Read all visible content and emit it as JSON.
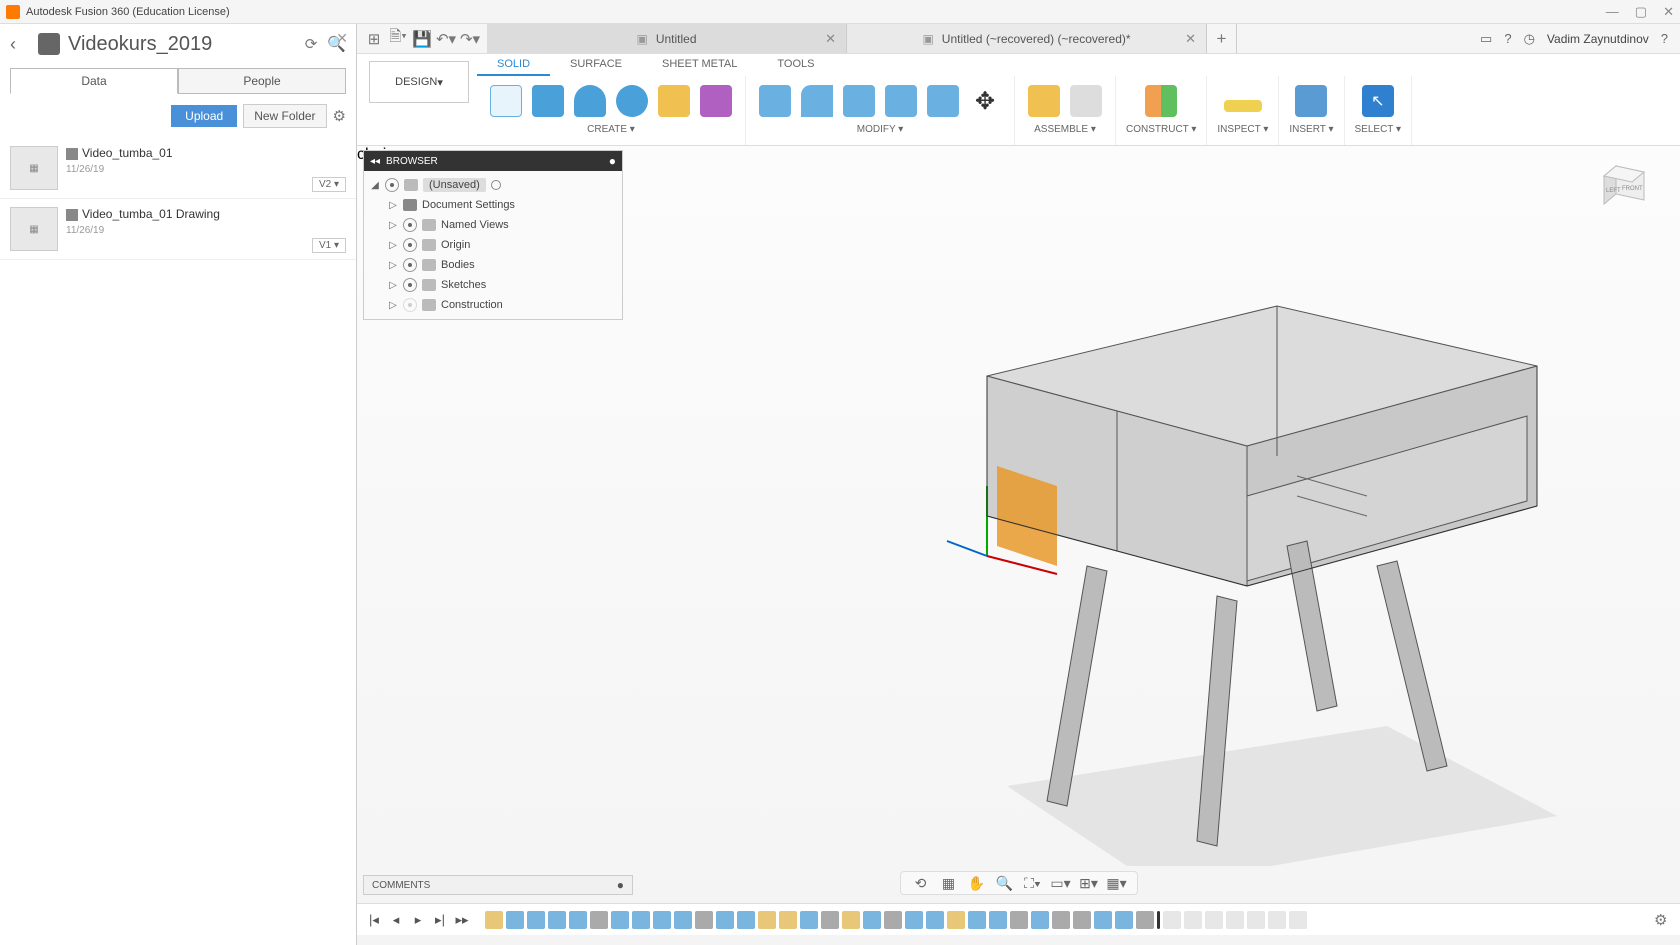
{
  "app_title": "Autodesk Fusion 360 (Education License)",
  "data_panel": {
    "project_title": "Videokurs_2019",
    "tab_data": "Data",
    "tab_people": "People",
    "btn_upload": "Upload",
    "btn_newfolder": "New Folder",
    "items": [
      {
        "name": "Video_tumba_01",
        "date": "11/26/19",
        "version": "V2"
      },
      {
        "name": "Video_tumba_01 Drawing",
        "date": "11/26/19",
        "version": "V1"
      }
    ]
  },
  "tabs": {
    "tab1": "Untitled",
    "tab2": "Untitled (~recovered) (~recovered)*"
  },
  "user": "Vadim Zaynutdinov",
  "workspace_dd": "DESIGN",
  "ws_tabs": {
    "solid": "SOLID",
    "surface": "SURFACE",
    "sheetmetal": "SHEET METAL",
    "tools": "TOOLS"
  },
  "ribbon": {
    "create": "CREATE",
    "modify": "MODIFY",
    "assemble": "ASSEMBLE",
    "construct": "CONSTRUCT",
    "inspect": "INSPECT",
    "insert": "INSERT",
    "select": "SELECT"
  },
  "browser": {
    "title": "BROWSER",
    "root": "(Unsaved)",
    "nodes": {
      "docsettings": "Document Settings",
      "namedviews": "Named Views",
      "origin": "Origin",
      "bodies": "Bodies",
      "sketches": "Sketches",
      "construction": "Construction"
    }
  },
  "comments": "COMMENTS",
  "viewcube": {
    "left": "LEFT",
    "front": "FRONT"
  }
}
